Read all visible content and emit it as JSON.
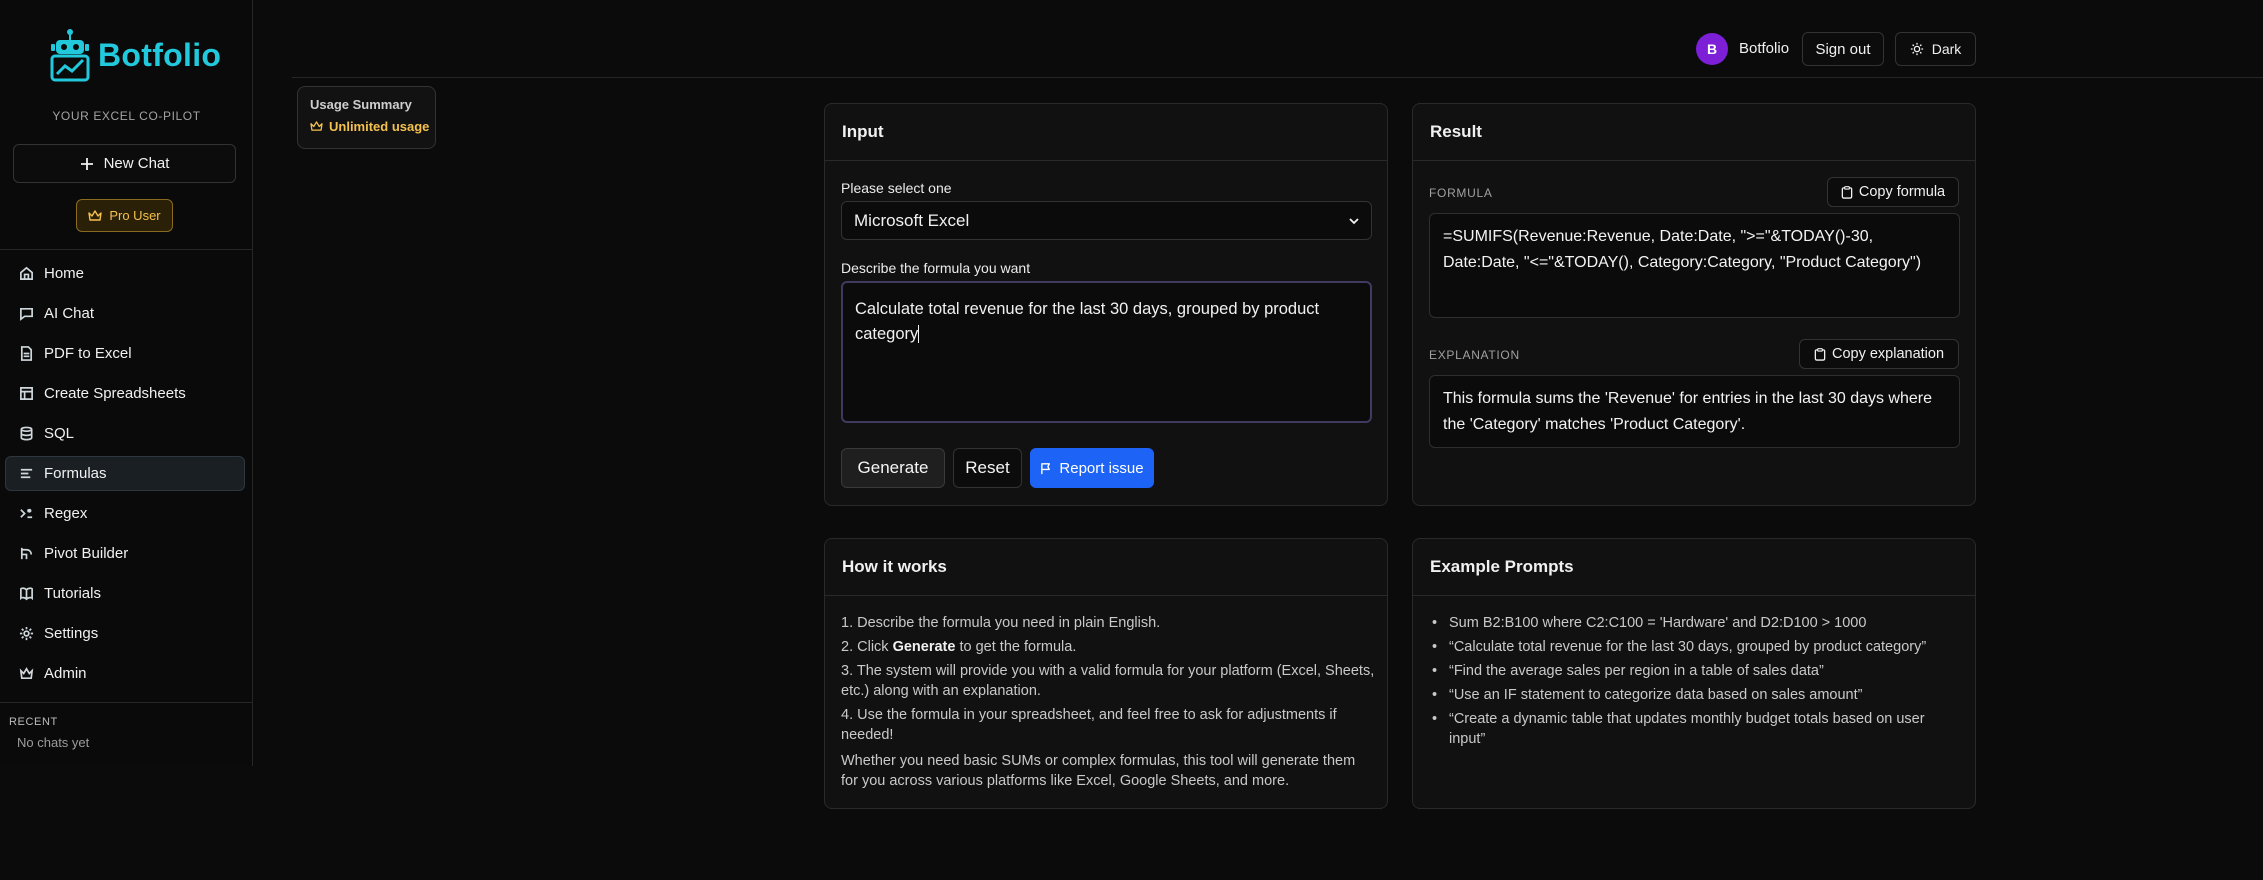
{
  "brand": {
    "name": "Botfolio",
    "tagline": "YOUR EXCEL CO-PILOT",
    "color": "#22c8dc"
  },
  "sidebar": {
    "new_chat": "New Chat",
    "pro_badge": "Pro User",
    "items": [
      {
        "label": "Home",
        "icon": "home-icon"
      },
      {
        "label": "AI Chat",
        "icon": "chat-icon"
      },
      {
        "label": "PDF to Excel",
        "icon": "file-icon"
      },
      {
        "label": "Create Spreadsheets",
        "icon": "table-icon"
      },
      {
        "label": "SQL",
        "icon": "database-icon"
      },
      {
        "label": "Formulas",
        "icon": "formula-icon",
        "active": true
      },
      {
        "label": "Regex",
        "icon": "regex-icon"
      },
      {
        "label": "Pivot Builder",
        "icon": "pivot-icon"
      },
      {
        "label": "Tutorials",
        "icon": "book-icon"
      },
      {
        "label": "Settings",
        "icon": "gear-icon"
      },
      {
        "label": "Admin",
        "icon": "crown-icon"
      }
    ],
    "recent_title": "RECENT",
    "recent_empty": "No chats yet"
  },
  "topbar": {
    "avatar_initial": "B",
    "user_name": "Botfolio",
    "sign_out": "Sign out",
    "theme": "Dark"
  },
  "usage": {
    "title": "Usage Summary",
    "badge": "Unlimited usage"
  },
  "input_card": {
    "title": "Input",
    "select_label": "Please select one",
    "select_value": "Microsoft Excel",
    "describe_label": "Describe the formula you want",
    "describe_value": "Calculate total revenue for the last 30 days, grouped by product category",
    "generate": "Generate",
    "reset": "Reset",
    "report": "Report issue"
  },
  "result_card": {
    "title": "Result",
    "formula_label": "FORMULA",
    "copy_formula": "Copy formula",
    "formula": "=SUMIFS(Revenue:Revenue, Date:Date, \">=\"&TODAY()-30, Date:Date, \"<=\"&TODAY(), Category:Category, \"Product Category\")",
    "explanation_label": "EXPLANATION",
    "copy_explanation": "Copy explanation",
    "explanation": "This formula sums the 'Revenue' for entries in the last 30 days where the 'Category' matches 'Product Category'."
  },
  "how_card": {
    "title": "How it works",
    "step1": "1. Describe the formula you need in plain English.",
    "step2_pre": "2. Click ",
    "step2_bold": "Generate",
    "step2_post": " to get the formula.",
    "step3": "3. The system will provide you with a valid formula for your platform (Excel, Sheets, etc.) along with an explanation.",
    "step4": "4. Use the formula in your spreadsheet, and feel free to ask for adjustments if needed!",
    "closing": "Whether you need basic SUMs or complex formulas, this tool will generate them for you across various platforms like Excel, Google Sheets, and more."
  },
  "examples_card": {
    "title": "Example Prompts",
    "items": [
      "Sum B2:B100 where C2:C100 = 'Hardware' and D2:D100 > 1000",
      "“Calculate total revenue for the last 30 days, grouped by product category”",
      "“Find the average sales per region in a table of sales data”",
      "“Use an IF statement to categorize data based on sales amount”",
      "“Create a dynamic table that updates monthly budget totals based on user input”"
    ]
  }
}
